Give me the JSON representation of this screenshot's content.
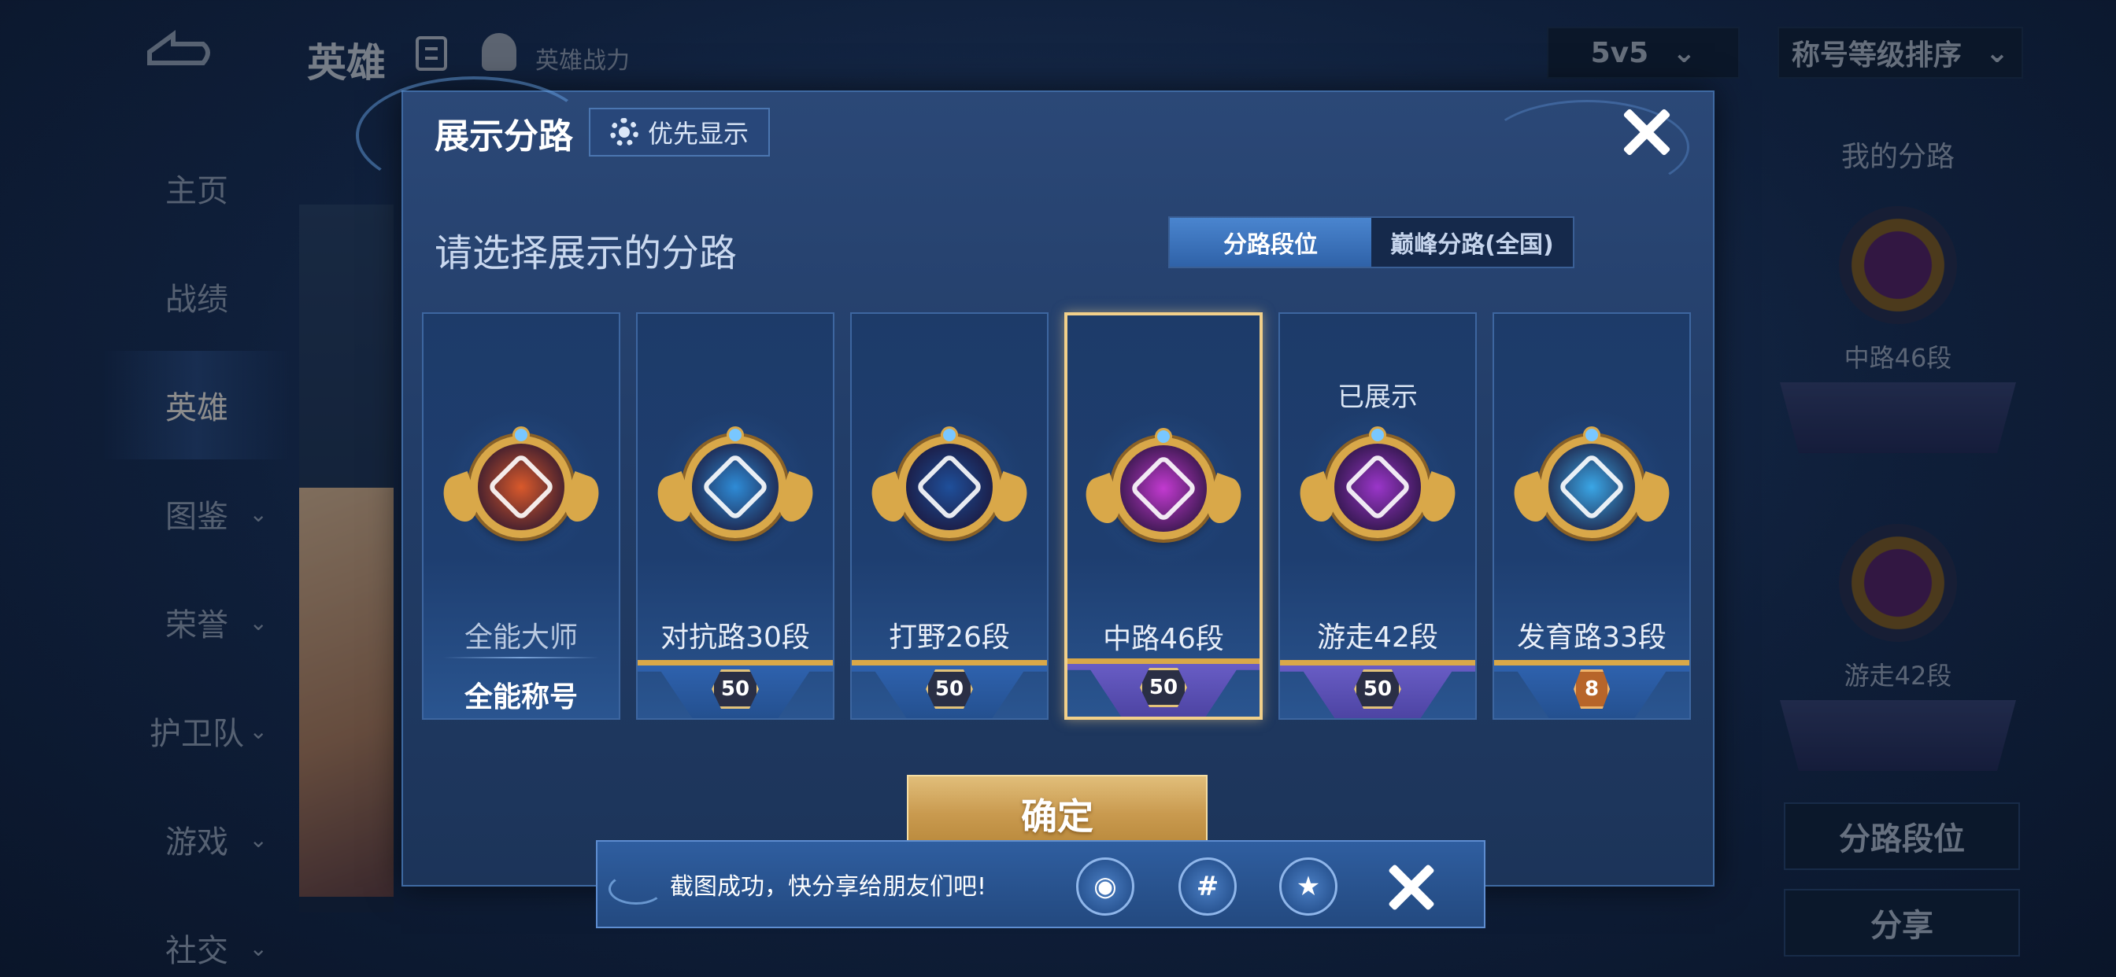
{
  "background": {
    "title": "英雄",
    "hero_power": "英雄战力",
    "mode_select": "5v5",
    "sort_select": "称号等级排序",
    "nav": [
      "主页",
      "战绩",
      "英雄",
      "图鉴",
      "荣誉",
      "护卫队",
      "游戏",
      "社交"
    ],
    "nav_active_index": 2,
    "right_title": "我的分路",
    "right_badges": [
      {
        "label": "中路46段"
      },
      {
        "label": "游走42段"
      }
    ],
    "right_buttons": [
      "分路段位",
      "分享"
    ]
  },
  "modal": {
    "title": "展示分路",
    "priority_label": "优先显示",
    "subtitle": "请选择展示的分路",
    "tabs": [
      "分路段位",
      "巅峰分路(全国)"
    ],
    "active_tab": 0,
    "cards": [
      {
        "label": "全能大师",
        "extra": "全能称号",
        "badge": "",
        "emblem_color": "#d9592b",
        "shown": ""
      },
      {
        "label": "对抗路30段",
        "extra": "",
        "badge": "50",
        "emblem_color": "#2e8bd6",
        "shown": ""
      },
      {
        "label": "打野26段",
        "extra": "",
        "badge": "50",
        "emblem_color": "#1f4f9a",
        "shown": ""
      },
      {
        "label": "中路46段",
        "extra": "",
        "badge": "50",
        "emblem_color": "#c23ad0",
        "shown": ""
      },
      {
        "label": "游走42段",
        "extra": "",
        "badge": "50",
        "emblem_color": "#9a36c9",
        "shown": "已展示"
      },
      {
        "label": "发育路33段",
        "extra": "",
        "badge": "8",
        "emblem_color": "#3aa6e6",
        "shown": ""
      }
    ],
    "selected_index": 3,
    "confirm_label": "确定"
  },
  "toast": {
    "message": "截图成功，快分享给朋友们吧!",
    "icons": [
      "qq-icon",
      "wechat-icon",
      "qzone-icon"
    ]
  }
}
